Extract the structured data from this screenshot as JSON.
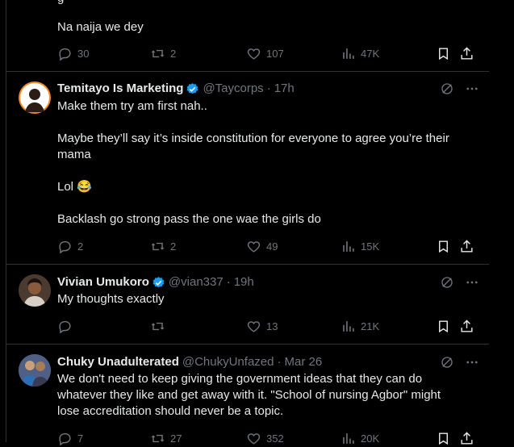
{
  "top_tweet": {
    "partial_text": "g",
    "text": "Na naija we dey",
    "stats": {
      "replies": "30",
      "reposts": "2",
      "likes": "107",
      "views": "47K"
    }
  },
  "tweets": [
    {
      "name": "Temitayo Is Marketing",
      "handle": "@Taycorps",
      "time": "17h",
      "verified": true,
      "lines": [
        "Make them try am first nah..",
        "Maybe they’ll say it’s inside constitution for everyone to agree you’re their",
        "mama",
        "Lol 😂",
        "Backlash go strong pass the one wae the girls do"
      ],
      "stats": {
        "replies": "2",
        "reposts": "2",
        "likes": "49",
        "views": "15K"
      }
    },
    {
      "name": "Vivian Umukoro",
      "handle": "@vian337",
      "time": "19h",
      "verified": true,
      "lines": [
        "My thoughts exactly"
      ],
      "stats": {
        "replies": "",
        "reposts": "",
        "likes": "13",
        "views": "21K"
      }
    },
    {
      "name": "Chuky Unadulterated",
      "handle": "@ChukyUnfazed",
      "time": "Mar 26",
      "verified": false,
      "lines": [
        "We don't need to keep giving the government ideas that they can do",
        "whatever they like and get away with it. \"School of nursing Agbor\" might",
        "lose accreditation should never be a topic."
      ],
      "stats": {
        "replies": "7",
        "reposts": "27",
        "likes": "352",
        "views": "20K"
      }
    }
  ],
  "separator": "·",
  "colors": {
    "background": "#000000",
    "text": "#e7e9ea",
    "muted": "#71767b",
    "border": "#2f3336",
    "verified": "#1d9bf0"
  }
}
